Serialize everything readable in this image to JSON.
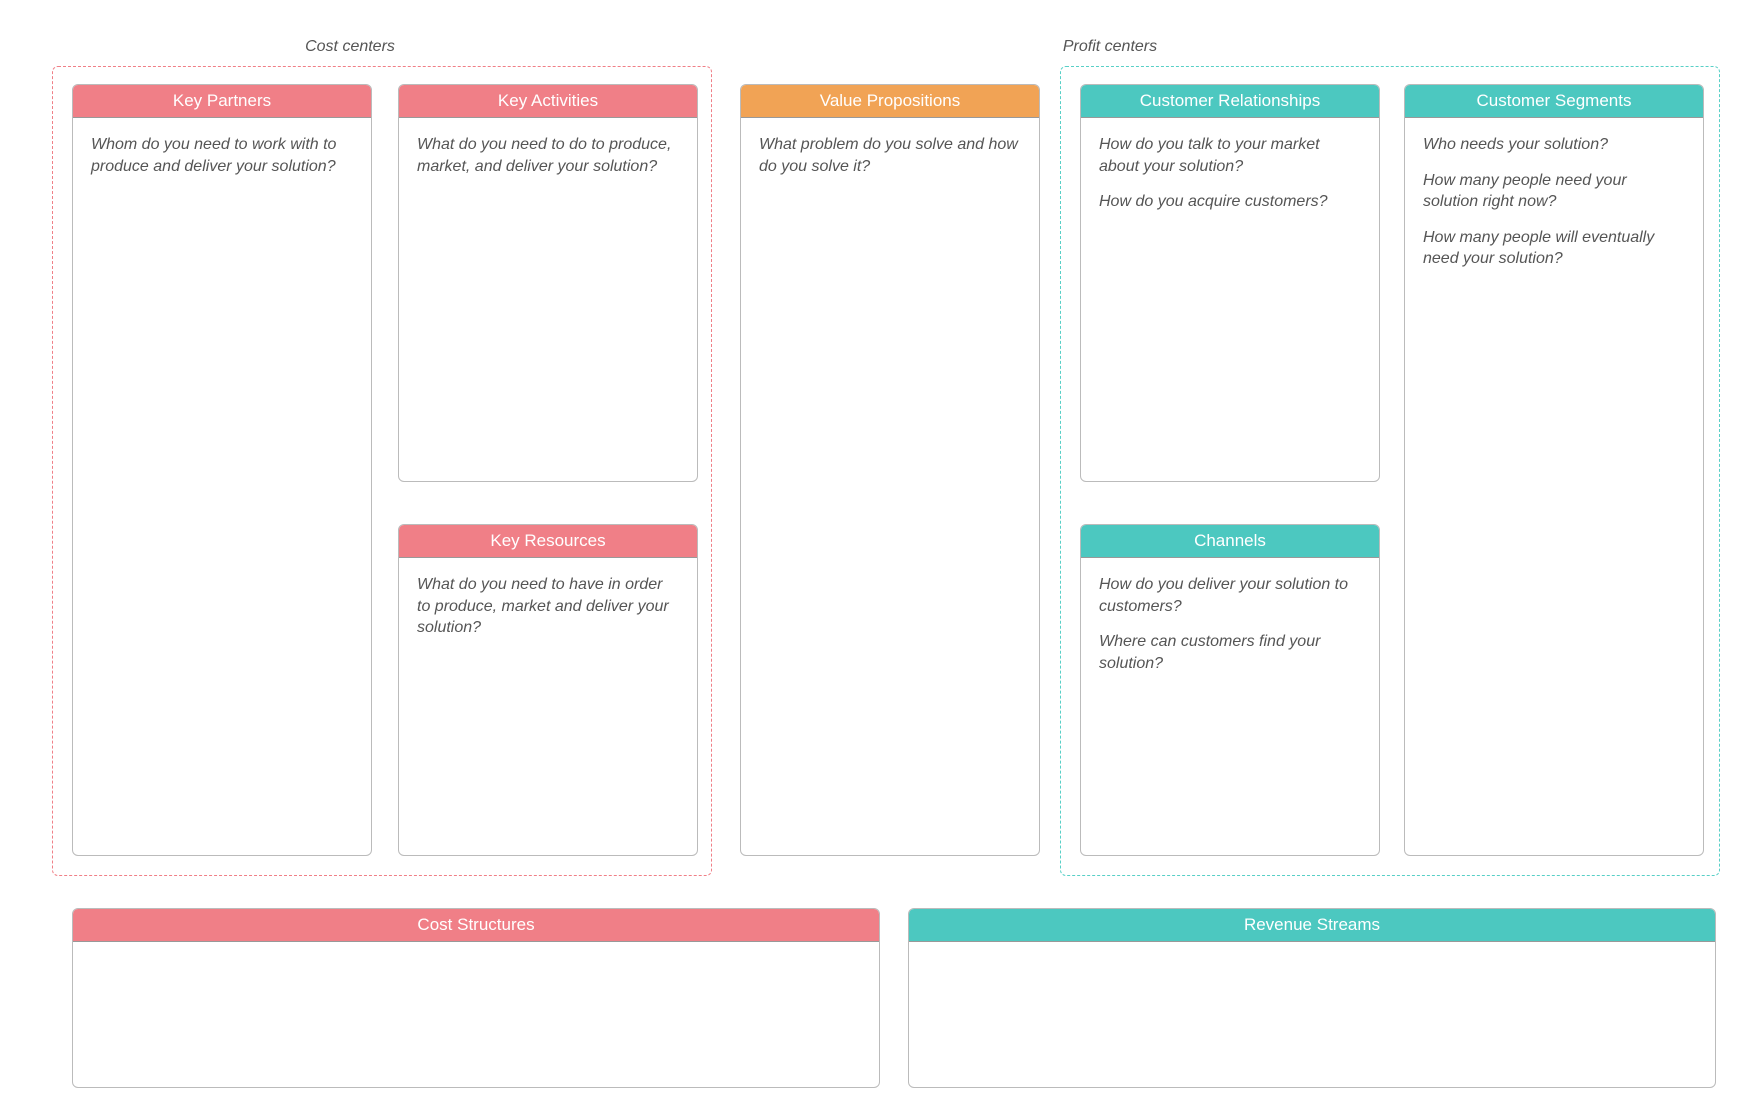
{
  "groups": {
    "cost": {
      "label": "Cost centers"
    },
    "profit": {
      "label": "Profit centers"
    }
  },
  "cards": {
    "keyPartners": {
      "title": "Key Partners",
      "prompts": [
        "Whom do you need to work with to produce and deliver your solution?"
      ]
    },
    "keyActivities": {
      "title": "Key Activities",
      "prompts": [
        "What do you need to do to produce, market, and deliver your solution?"
      ]
    },
    "keyResources": {
      "title": "Key Resources",
      "prompts": [
        "What do you need to have in order to produce, market and deliver your solution?"
      ]
    },
    "valuePropositions": {
      "title": "Value Propositions",
      "prompts": [
        "What problem do you solve and how do you solve it?"
      ]
    },
    "customerRelationships": {
      "title": "Customer Relationships",
      "prompts": [
        "How do you talk to your market about your solution?",
        "How do you acquire customers?"
      ]
    },
    "channels": {
      "title": "Channels",
      "prompts": [
        "How do you deliver your solution to customers?",
        "Where can customers find your solution?"
      ]
    },
    "customerSegments": {
      "title": "Customer Segments",
      "prompts": [
        "Who needs your solution?",
        "How many people need your solution right now?",
        "How many people will eventually need your solution?"
      ]
    },
    "costStructures": {
      "title": "Cost Structures",
      "prompts": []
    },
    "revenueStreams": {
      "title": "Revenue Streams",
      "prompts": []
    }
  }
}
